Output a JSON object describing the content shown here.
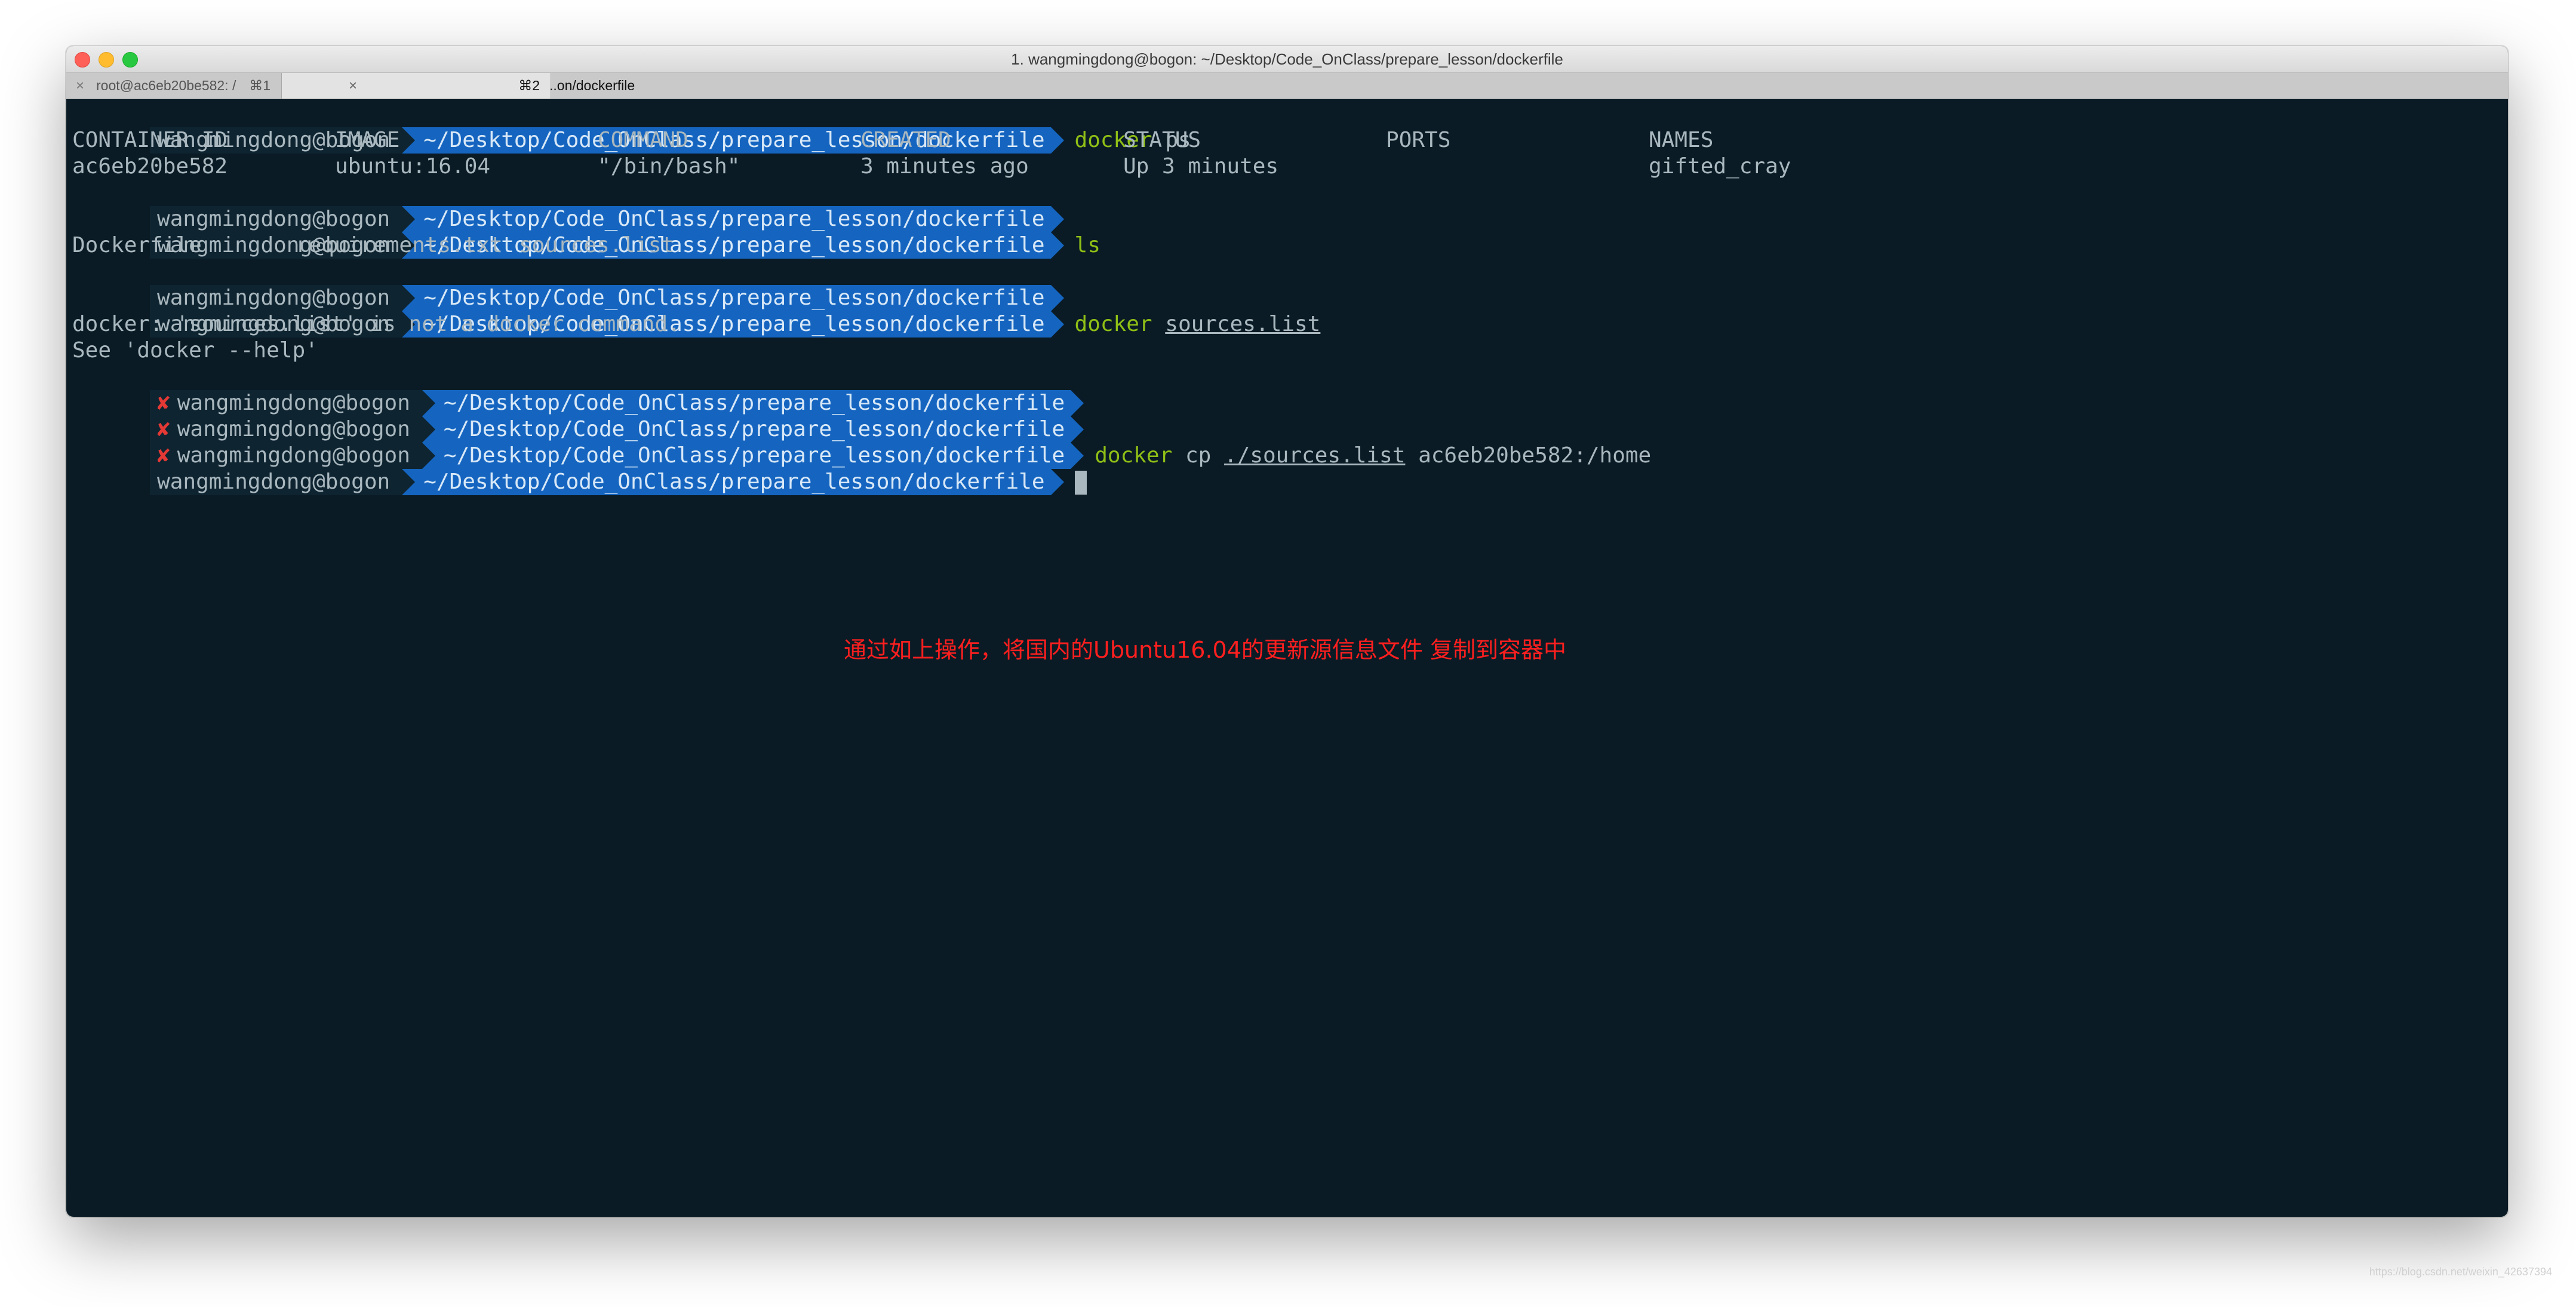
{
  "window": {
    "title": "1. wangmingdong@bogon: ~/Desktop/Code_OnClass/prepare_lesson/dockerfile"
  },
  "tabs": [
    {
      "label": "root@ac6eb20be582: /",
      "shortcut": "⌘1",
      "active": false
    },
    {
      "label": "..on/dockerfile",
      "shortcut": "⌘2",
      "active": true
    }
  ],
  "prompt": {
    "user": "wangmingdong@bogon",
    "path": "~/Desktop/Code_OnClass/prepare_lesson/dockerfile",
    "error_mark": "✘"
  },
  "lines": [
    {
      "cmd": "docker",
      "args": " ps"
    },
    {
      "cmd": "",
      "args": ""
    },
    {
      "cmd": "ls",
      "args": ""
    },
    {
      "cmd": "",
      "args": ""
    },
    {
      "cmd": "docker",
      "args_underlined": "sources.list"
    },
    {
      "cmd": "",
      "args": ""
    },
    {
      "cmd": "",
      "args": ""
    },
    {
      "cmd": "docker",
      "args_pre": " cp ",
      "args_underlined": "./sources.list",
      "args_post": " ac6eb20be582:/home"
    },
    {
      "cmd": "",
      "args": ""
    }
  ],
  "ps_table": {
    "headers": [
      "CONTAINER ID",
      "IMAGE",
      "COMMAND",
      "CREATED",
      "STATUS",
      "PORTS",
      "NAMES"
    ],
    "rows": [
      [
        "ac6eb20be582",
        "ubuntu:16.04",
        "\"/bin/bash\"",
        "3 minutes ago",
        "Up 3 minutes",
        "",
        "gifted_cray"
      ]
    ]
  },
  "ls_output": [
    "Dockerfile",
    "requirements.txt",
    "sources.list"
  ],
  "error_output": [
    "docker: 'sources.list' is not a docker command.",
    "See 'docker --help'"
  ],
  "annotation": "通过如上操作，将国内的Ubuntu16.04的更新源信息文件 复制到容器中",
  "watermark": "https://blog.csdn.net/weixin_42637394",
  "colors": {
    "terminal_bg": "#0a1b25",
    "path_bg": "#1565c0",
    "command": "#8fbf16",
    "error": "#e53935",
    "annotation": "#ff1f1f"
  }
}
